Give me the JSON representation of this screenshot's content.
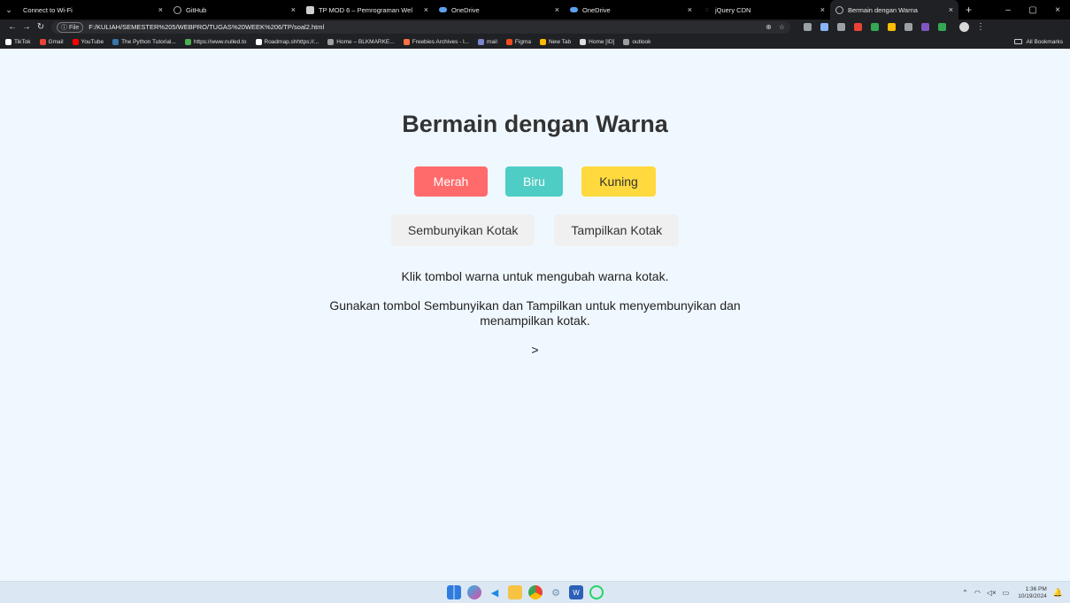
{
  "browser": {
    "tabs": [
      {
        "label": "Connect to Wi-Fi",
        "icon": "wifi-icon",
        "close": "×"
      },
      {
        "label": "GitHub",
        "icon": "github-icon",
        "close": "×"
      },
      {
        "label": "TP MOD 6 – Pemrograman Wel",
        "icon": "module-icon",
        "close": "×"
      },
      {
        "label": "OneDrive",
        "icon": "onedrive-icon",
        "close": "×"
      },
      {
        "label": "OneDrive",
        "icon": "onedrive-icon",
        "close": "×"
      },
      {
        "label": "jQuery CDN",
        "icon": "jquery-icon",
        "close": "×"
      },
      {
        "label": "Bermain dengan Warna",
        "icon": "globe-icon",
        "close": "×"
      }
    ],
    "new_tab": "+",
    "window_controls": {
      "minimize": "–",
      "restore": "▢",
      "close": "×"
    },
    "address": {
      "info_label": "File",
      "url": "F:/KULIAH/SEMESTER%205/WEBPRO/TUGAS%20WEEK%206/TP/soal2.html"
    },
    "bookmarks": [
      {
        "label": "TikTok",
        "color": "#ffffff"
      },
      {
        "label": "Gmail",
        "color": "#ea4335"
      },
      {
        "label": "YouTube",
        "color": "#ff0000"
      },
      {
        "label": "The Python Tutorial...",
        "color": "#3776ab"
      },
      {
        "label": "https://www.nulled.to",
        "color": "#4caf50"
      },
      {
        "label": "Roadmap.shhttps://...",
        "color": "#ffffff"
      },
      {
        "label": "Home – BLKMARKE...",
        "color": "#9e9e9e"
      },
      {
        "label": "Freebies Archives - l...",
        "color": "#ff7043"
      },
      {
        "label": "mail",
        "color": "#7986cb"
      },
      {
        "label": "Figma",
        "color": "#f24e1e"
      },
      {
        "label": "New Tab",
        "color": "#fbbc04"
      },
      {
        "label": "Home [ID]",
        "color": "#e0e0e0"
      },
      {
        "label": "outlook",
        "color": "#9e9e9e"
      }
    ],
    "all_bookmarks": "All Bookmarks",
    "extension_colors": [
      "#9aa0a6",
      "#8ab4f8",
      "#9aa0a6",
      "#ea4335",
      "#34a853",
      "#fbbc04",
      "#9aa0a6",
      "#7e57c2",
      "#34a853"
    ]
  },
  "page": {
    "title": "Bermain dengan Warna",
    "color_buttons": {
      "red": "Merah",
      "blue": "Biru",
      "yellow": "Kuning"
    },
    "toggle_buttons": {
      "hide": "Sembunyikan Kotak",
      "show": "Tampilkan Kotak"
    },
    "instruction_1": "Klik tombol warna untuk mengubah warna kotak.",
    "instruction_2": "Gunakan tombol Sembunyikan dan Tampilkan untuk menyembunyikan dan menampilkan kotak.",
    "stray_text": ">",
    "colors": {
      "red": "#ff6b6b",
      "blue": "#4ecdc4",
      "yellow": "#ffd93d",
      "background": "#f0f8ff"
    }
  },
  "taskbar": {
    "apps": [
      "windows-start-icon",
      "copilot-icon",
      "vscode-icon",
      "file-explorer-icon",
      "chrome-icon",
      "settings-icon",
      "word-icon",
      "whatsapp-icon"
    ],
    "time": "1:36 PM",
    "date": "10/19/2024"
  }
}
